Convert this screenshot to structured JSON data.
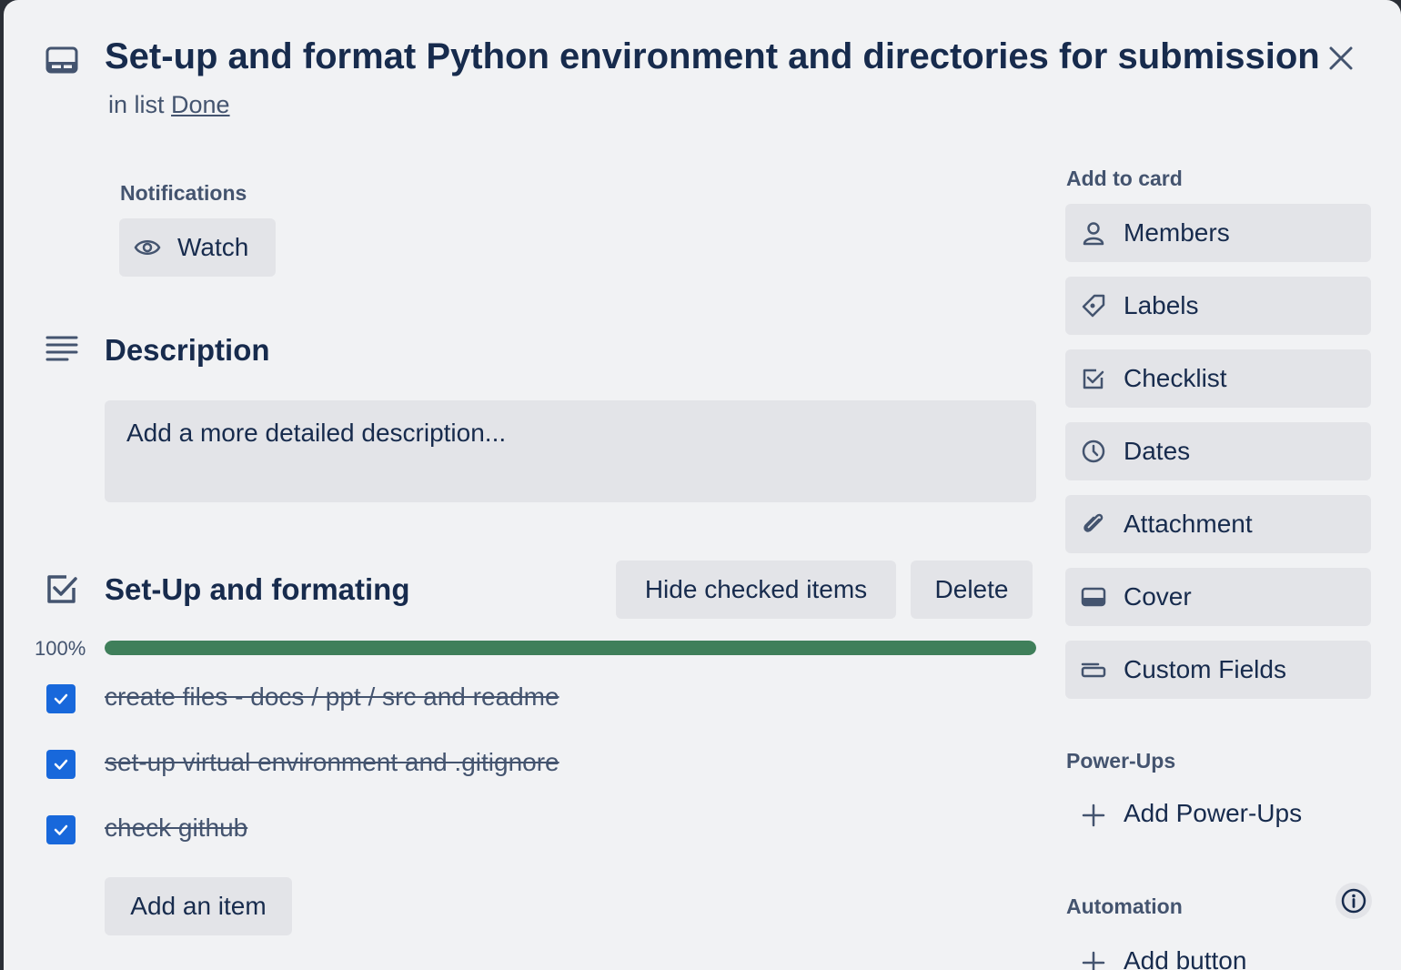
{
  "header": {
    "title": "Set-up and format Python environment and directories for submission",
    "in_list_prefix": "in list",
    "list_name": "Done",
    "icons": {
      "card": "card-icon",
      "close": "close-icon"
    }
  },
  "notifications": {
    "label": "Notifications",
    "watch_label": "Watch",
    "watch_icon": "eye-icon"
  },
  "description": {
    "title": "Description",
    "placeholder": "Add a more detailed description..."
  },
  "checklist": {
    "title": "Set-Up and formating",
    "hide_label": "Hide checked items",
    "delete_label": "Delete",
    "progress_label": "100%",
    "progress": 1.0,
    "progress_color": "#3f7f5a",
    "items": [
      {
        "text": "create files - docs / ppt / src and readme",
        "checked": true
      },
      {
        "text": "set-up virtual environment and .gitignore",
        "checked": true
      },
      {
        "text": "check github",
        "checked": true
      }
    ],
    "add_item_label": "Add an item",
    "checkbox_color": "#1868db"
  },
  "sidebar": {
    "add_to_card_label": "Add to card",
    "buttons": [
      {
        "label": "Members",
        "icon": "person-icon"
      },
      {
        "label": "Labels",
        "icon": "tag-icon"
      },
      {
        "label": "Checklist",
        "icon": "checkbox-icon"
      },
      {
        "label": "Dates",
        "icon": "clock-icon"
      },
      {
        "label": "Attachment",
        "icon": "paperclip-icon"
      },
      {
        "label": "Cover",
        "icon": "cover-icon"
      },
      {
        "label": "Custom Fields",
        "icon": "custom-fields-icon"
      }
    ],
    "powerups_label": "Power-Ups",
    "add_powerups_label": "Add Power-Ups",
    "automation_label": "Automation",
    "add_button_label": "Add button"
  }
}
